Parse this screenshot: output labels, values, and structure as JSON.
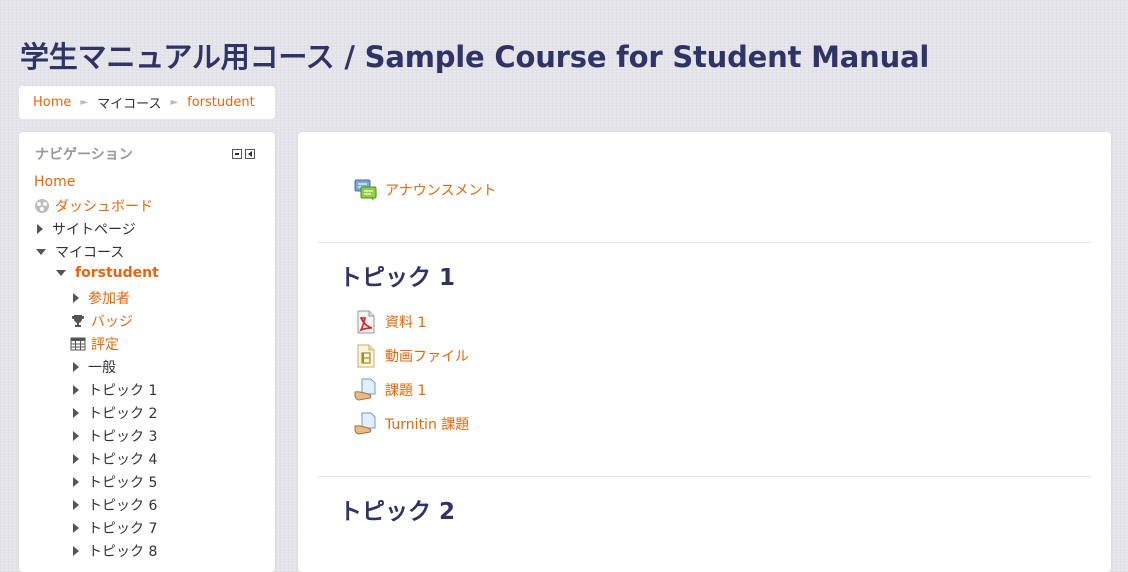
{
  "page": {
    "title": "学生マニュアル用コース / Sample Course for Student Manual"
  },
  "breadcrumb": {
    "items": [
      "Home",
      "マイコース",
      "forstudent"
    ],
    "separator": "►"
  },
  "navigation": {
    "title": "ナビゲーション",
    "items": [
      {
        "label": "Home",
        "icon": "none"
      },
      {
        "label": "ダッシュボード",
        "icon": "dashboard-icon"
      },
      {
        "label": "サイトページ",
        "icon": "expand-arrow-icon"
      },
      {
        "label": "マイコース",
        "icon": "collapse-arrow-icon"
      },
      {
        "label": "forstudent",
        "icon": "collapse-arrow-icon"
      },
      {
        "label": "参加者",
        "icon": "expand-arrow-icon"
      },
      {
        "label": "バッジ",
        "icon": "trophy-icon"
      },
      {
        "label": "評定",
        "icon": "grades-table-icon"
      },
      {
        "label": "一般",
        "icon": "expand-arrow-icon"
      },
      {
        "label": "トピック 1",
        "icon": "expand-arrow-icon"
      },
      {
        "label": "トピック 2",
        "icon": "expand-arrow-icon"
      },
      {
        "label": "トピック 3",
        "icon": "expand-arrow-icon"
      },
      {
        "label": "トピック 4",
        "icon": "expand-arrow-icon"
      },
      {
        "label": "トピック 5",
        "icon": "expand-arrow-icon"
      },
      {
        "label": "トピック 6",
        "icon": "expand-arrow-icon"
      },
      {
        "label": "トピック 7",
        "icon": "expand-arrow-icon"
      },
      {
        "label": "トピック 8",
        "icon": "expand-arrow-icon"
      }
    ]
  },
  "main": {
    "general_section": {
      "activities": [
        {
          "label": "アナウンスメント",
          "icon": "forum-icon"
        }
      ]
    },
    "sections": [
      {
        "title": "トピック 1",
        "activities": [
          {
            "label": "資料 1",
            "icon": "pdf-icon"
          },
          {
            "label": "動画ファイル",
            "icon": "video-file-icon"
          },
          {
            "label": "課題 1",
            "icon": "assignment-icon"
          },
          {
            "label": "Turnitin 課題",
            "icon": "turnitin-assignment-icon"
          }
        ]
      },
      {
        "title": "トピック 2",
        "activities": []
      }
    ]
  },
  "colors": {
    "accent_link": "#e8650e",
    "heading": "#2f3365",
    "background": "#e3e3ea"
  }
}
